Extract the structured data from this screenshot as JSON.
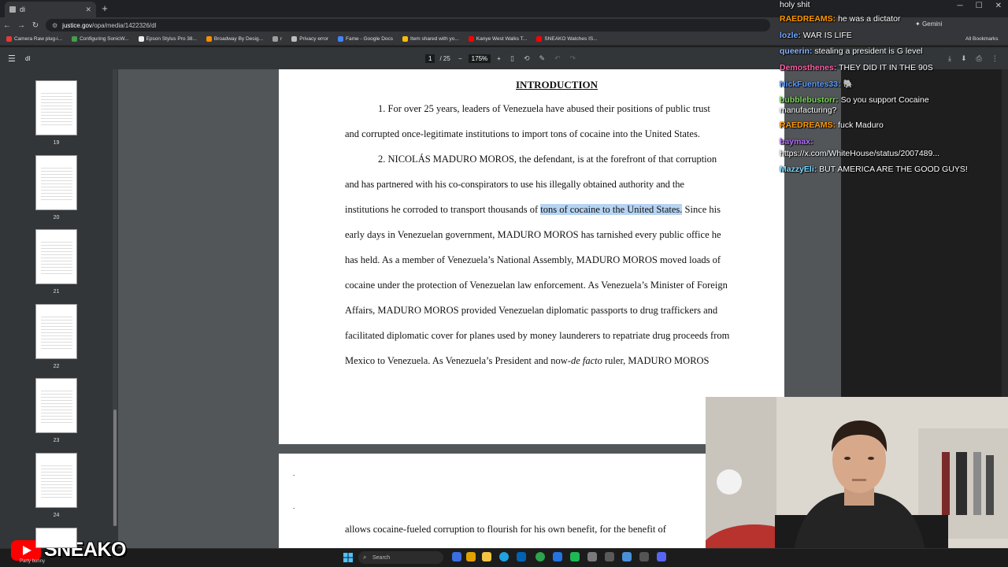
{
  "browser": {
    "tab_title": "di",
    "url_host": "justice.gov",
    "url_path": "/opa/media/1422326/dl",
    "gemini_label": "Gemini",
    "all_bookmarks": "All Bookmarks",
    "bookmarks": [
      {
        "label": "Camera Raw plug-i...",
        "color": "#e53935"
      },
      {
        "label": "Configuring SonicW...",
        "color": "#43a047"
      },
      {
        "label": "Epson Stylus Pro 38...",
        "color": "#eeeeee"
      },
      {
        "label": "Broadway By Desig...",
        "color": "#fb8c00"
      },
      {
        "label": "r",
        "color": "#9e9e9e"
      },
      {
        "label": "Privacy error",
        "color": "#bdbdbd"
      },
      {
        "label": "Fame - Google Docs",
        "color": "#4285f4"
      },
      {
        "label": "Item shared with yo...",
        "color": "#fbbc04"
      },
      {
        "label": "Kanye West Walks T...",
        "color": "#ff0000"
      },
      {
        "label": "SNEAKO Watches IS...",
        "color": "#ff0000"
      }
    ]
  },
  "pdf": {
    "title": "dl",
    "page_current": "1",
    "page_total": "/ 25",
    "zoom": "175%",
    "thumbnails": [
      "19",
      "20",
      "21",
      "22",
      "23",
      "24"
    ],
    "heading": "INTRODUCTION",
    "lines": [
      "1.        For over 25 years, leaders of Venezuela have abused their positions of public trust",
      "and corrupted once-legitimate institutions to import tons of cocaine into the United States.",
      "2.        NICOLÁS MADURO MOROS, the defendant, is at the forefront of that corruption",
      "and  has  partnered  with  his  co-conspirators  to  use  his  illegally  obtained  authority  and  the",
      "institutions he corroded to transport thousands of",
      "early days in Venezuelan government, MADURO MOROS has tarnished every public office he",
      "has held. As a member of Venezuela’s National Assembly, MADURO MOROS moved loads of",
      "cocaine under the protection of Venezuelan law enforcement. As Venezuela’s Minister of Foreign",
      "Affairs, MADURO MOROS provided Venezuelan diplomatic passports to drug traffickers and",
      "facilitated diplomatic cover for planes used by money launderers to repatriate drug proceeds from",
      "Mexico  to  Venezuela.  As  Venezuela’s  President  and  now-",
      "ruler,  MADURO  MOROS"
    ],
    "highlight": "tons of cocaine to the United States.",
    "after_highlight": " Since his",
    "italic": "de facto",
    "page2_line": "allows cocaine-fueled corruption to flourish for his own benefit, for the benefit of"
  },
  "chat": [
    {
      "user": "",
      "text": "holy shit",
      "color": "#ffffff"
    },
    {
      "user": "RAEDREAMS:",
      "text": " he was a dictator",
      "color": "#ff9800"
    },
    {
      "user": "lozle:",
      "text": " WAR IS LIFE",
      "color": "#6fa8ff"
    },
    {
      "user": "queerin:",
      "text": " stealing a president is G level",
      "color": "#8ab4ff"
    },
    {
      "user": "Demosthenes:",
      "text": " THEY DID IT IN THE 90S",
      "color": "#ff5ea8"
    },
    {
      "user": "NickFuentes33:",
      "text": " 🐘",
      "color": "#5b9bff"
    },
    {
      "user": "bubblebustorr:",
      "text": " So you support Cocaine",
      "color": "#7ed957"
    },
    {
      "user": "",
      "text": "manufacturing?",
      "color": "#ffffff"
    },
    {
      "user": "RAEDREAMS:",
      "text": " fuck Maduro",
      "color": "#ff9800"
    },
    {
      "user": "baymax:",
      "text": "",
      "color": "#b36bff"
    },
    {
      "user": "",
      "text": "https://x.com/WhiteHouse/status/2007489...",
      "color": "#ffffff"
    },
    {
      "user": "MazzyEli:",
      "text": " BUT AMERICA ARE THE GOOD GUYS!",
      "color": "#7ad7ff"
    }
  ],
  "taskbar": {
    "search_placeholder": "Search",
    "streamer": "SNEAKO",
    "now_playing": "Party bunny"
  }
}
